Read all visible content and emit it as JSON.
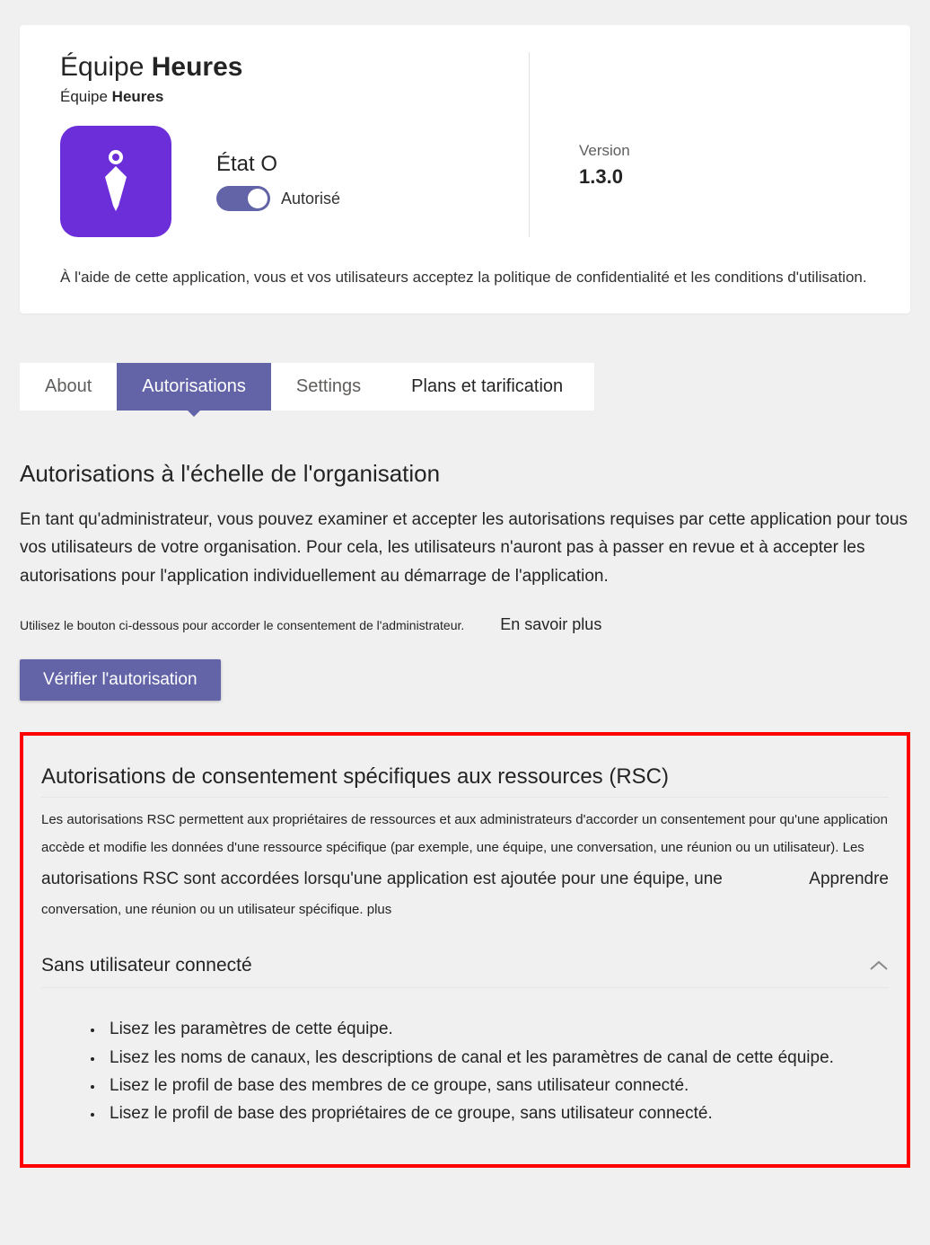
{
  "header": {
    "title_prefix": "Équipe ",
    "title_bold": "Heures",
    "subtitle_prefix": "Équipe ",
    "subtitle_bold": "Heures",
    "state_label": "État O",
    "toggle_value": "Autorisé",
    "version_label": "Version",
    "version_value": "1.3.0",
    "disclaimer": "À l'aide de cette application, vous et vos utilisateurs acceptez la politique de confidentialité et les conditions d'utilisation."
  },
  "tabs": [
    {
      "label": "About",
      "active": false
    },
    {
      "label": "Autorisations",
      "active": true
    },
    {
      "label": "Settings",
      "active": false
    },
    {
      "label": "Plans et tarification",
      "active": false
    }
  ],
  "org_section": {
    "title": "Autorisations à l'échelle de l'organisation",
    "text": "En tant qu'administrateur, vous pouvez examiner et accepter les autorisations requises par cette application pour tous vos utilisateurs de votre organisation. Pour cela, les utilisateurs n'auront pas à passer en revue et à accepter les autorisations pour l'application individuellement au démarrage de l'application.",
    "hint": "Utilisez le bouton ci-dessous pour accorder le consentement de l'administrateur.",
    "learn_more": "En savoir plus",
    "verify_button": "Vérifier l'autorisation"
  },
  "rsc_section": {
    "title": "Autorisations de consentement spécifiques aux ressources (RSC)",
    "desc_part1": "Les autorisations RSC permettent aux propriétaires de ressources et aux administrateurs d'accorder un consentement pour qu'une application accède et modifie les données d'une ressource spécifique (par exemple, une équipe, une conversation, une réunion ou un utilisateur). Les ",
    "desc_big": "autorisations RSC sont accordées lorsqu'une application est ajoutée pour une équipe, une ",
    "desc_part2": "conversation, une réunion ou un utilisateur spécifique. plus",
    "learn": "Apprendre",
    "collapse_title": "Sans utilisateur connecté",
    "permissions": [
      "Lisez les paramètres de cette équipe.",
      "Lisez les noms de canaux, les descriptions de canal et les paramètres de canal de cette équipe.",
      "Lisez le profil de base des membres de ce groupe, sans utilisateur connecté.",
      "Lisez le profil de base des propriétaires de ce groupe, sans utilisateur connecté."
    ]
  }
}
